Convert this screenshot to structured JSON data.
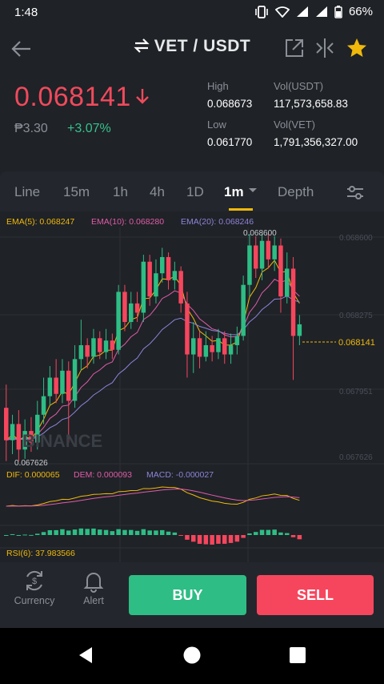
{
  "status_bar": {
    "time": "1:48",
    "battery": "66%"
  },
  "header": {
    "title": "VET / USDT"
  },
  "price": {
    "last": "0.068141",
    "fiat": "₱3.30",
    "change": "+3.07%",
    "high_label": "High",
    "high_value": "0.068673",
    "low_label": "Low",
    "low_value": "0.061770",
    "vol_usdt_label": "Vol(USDT)",
    "vol_usdt_value": "117,573,658.83",
    "vol_vet_label": "Vol(VET)",
    "vol_vet_value": "1,791,356,327.00"
  },
  "tabs": [
    {
      "label": "Line"
    },
    {
      "label": "15m"
    },
    {
      "label": "1h"
    },
    {
      "label": "4h"
    },
    {
      "label": "1D"
    },
    {
      "label": "1m"
    },
    {
      "label": "Depth"
    }
  ],
  "chart": {
    "ema5": "EMA(5): 0.068247",
    "ema10": "EMA(10): 0.068280",
    "ema20": "EMA(20): 0.068246",
    "max_label": "0.068600",
    "min_label": "0.067626",
    "axis": [
      "0.068600",
      "0.068275",
      "0.067951",
      "0.067626"
    ],
    "current_price_tag": "0.068141",
    "watermark": "BINANCE",
    "dif": "DIF: 0.000065",
    "dem": "DEM: 0.000093",
    "macd": "MACD: -0.000027",
    "rsi": "RSI(6): 37.983566",
    "colors": {
      "up": "#2ebd85",
      "down": "#f6465d",
      "ema5": "#f0b90b",
      "ema10": "#e05ca8",
      "ema20": "#8f83d8"
    }
  },
  "chart_data": {
    "type": "candlestick",
    "ylim": [
      0.067626,
      0.0686
    ],
    "candles": [
      {
        "o": 0.06785,
        "c": 0.06771,
        "h": 0.06795,
        "l": 0.06762
      },
      {
        "o": 0.06771,
        "c": 0.06778,
        "h": 0.06782,
        "l": 0.06765
      },
      {
        "o": 0.06778,
        "c": 0.06767,
        "h": 0.06784,
        "l": 0.06762
      },
      {
        "o": 0.06767,
        "c": 0.06775,
        "h": 0.0678,
        "l": 0.06763
      },
      {
        "o": 0.06775,
        "c": 0.0677,
        "h": 0.06781,
        "l": 0.06766
      },
      {
        "o": 0.0677,
        "c": 0.06782,
        "h": 0.06788,
        "l": 0.06767
      },
      {
        "o": 0.06782,
        "c": 0.0679,
        "h": 0.06798,
        "l": 0.06778
      },
      {
        "o": 0.0679,
        "c": 0.06798,
        "h": 0.06803,
        "l": 0.06786
      },
      {
        "o": 0.06798,
        "c": 0.06791,
        "h": 0.06806,
        "l": 0.06787
      },
      {
        "o": 0.06791,
        "c": 0.06801,
        "h": 0.06806,
        "l": 0.06787
      },
      {
        "o": 0.06801,
        "c": 0.06788,
        "h": 0.06805,
        "l": 0.0677
      },
      {
        "o": 0.06788,
        "c": 0.06806,
        "h": 0.06812,
        "l": 0.06785
      },
      {
        "o": 0.06806,
        "c": 0.06812,
        "h": 0.06823,
        "l": 0.06801
      },
      {
        "o": 0.06812,
        "c": 0.06807,
        "h": 0.06815,
        "l": 0.06802
      },
      {
        "o": 0.06807,
        "c": 0.06815,
        "h": 0.06819,
        "l": 0.06804
      },
      {
        "o": 0.06815,
        "c": 0.06809,
        "h": 0.06818,
        "l": 0.06806
      },
      {
        "o": 0.06809,
        "c": 0.06814,
        "h": 0.06819,
        "l": 0.06806
      },
      {
        "o": 0.06814,
        "c": 0.0681,
        "h": 0.06817,
        "l": 0.06806
      },
      {
        "o": 0.0681,
        "c": 0.06835,
        "h": 0.06838,
        "l": 0.06808
      },
      {
        "o": 0.06835,
        "c": 0.06822,
        "h": 0.06838,
        "l": 0.06818
      },
      {
        "o": 0.06822,
        "c": 0.0683,
        "h": 0.06835,
        "l": 0.06819
      },
      {
        "o": 0.0683,
        "c": 0.06826,
        "h": 0.06835,
        "l": 0.06822
      },
      {
        "o": 0.06826,
        "c": 0.06848,
        "h": 0.06851,
        "l": 0.06822
      },
      {
        "o": 0.06848,
        "c": 0.06833,
        "h": 0.06851,
        "l": 0.06829
      },
      {
        "o": 0.06833,
        "c": 0.06843,
        "h": 0.06849,
        "l": 0.0683
      },
      {
        "o": 0.06843,
        "c": 0.0685,
        "h": 0.06854,
        "l": 0.06839
      },
      {
        "o": 0.0685,
        "c": 0.0684,
        "h": 0.06852,
        "l": 0.06836
      },
      {
        "o": 0.0684,
        "c": 0.06844,
        "h": 0.06848,
        "l": 0.06836
      },
      {
        "o": 0.06844,
        "c": 0.0683,
        "h": 0.06846,
        "l": 0.06826
      },
      {
        "o": 0.0683,
        "c": 0.06808,
        "h": 0.06835,
        "l": 0.06798
      },
      {
        "o": 0.06808,
        "c": 0.06815,
        "h": 0.06822,
        "l": 0.068
      },
      {
        "o": 0.06815,
        "c": 0.06807,
        "h": 0.06818,
        "l": 0.06802
      },
      {
        "o": 0.06807,
        "c": 0.06812,
        "h": 0.06818,
        "l": 0.06805
      },
      {
        "o": 0.06812,
        "c": 0.06809,
        "h": 0.06816,
        "l": 0.06805
      },
      {
        "o": 0.06809,
        "c": 0.06815,
        "h": 0.06819,
        "l": 0.06806
      },
      {
        "o": 0.06815,
        "c": 0.06808,
        "h": 0.06818,
        "l": 0.06804
      },
      {
        "o": 0.06808,
        "c": 0.06812,
        "h": 0.06817,
        "l": 0.06804
      },
      {
        "o": 0.06812,
        "c": 0.06816,
        "h": 0.0682,
        "l": 0.06808
      },
      {
        "o": 0.06816,
        "c": 0.06838,
        "h": 0.06842,
        "l": 0.06814
      },
      {
        "o": 0.06838,
        "c": 0.06855,
        "h": 0.0686,
        "l": 0.06833
      },
      {
        "o": 0.06855,
        "c": 0.06845,
        "h": 0.06859,
        "l": 0.06841
      },
      {
        "o": 0.06845,
        "c": 0.06857,
        "h": 0.0686,
        "l": 0.0684
      },
      {
        "o": 0.06857,
        "c": 0.06849,
        "h": 0.0686,
        "l": 0.06845
      },
      {
        "o": 0.06849,
        "c": 0.06855,
        "h": 0.06859,
        "l": 0.06844
      },
      {
        "o": 0.06855,
        "c": 0.06833,
        "h": 0.06858,
        "l": 0.06826
      },
      {
        "o": 0.06833,
        "c": 0.06845,
        "h": 0.06852,
        "l": 0.0683
      },
      {
        "o": 0.06845,
        "c": 0.06816,
        "h": 0.0685,
        "l": 0.06797
      },
      {
        "o": 0.06816,
        "c": 0.06821,
        "h": 0.06825,
        "l": 0.06812
      }
    ]
  },
  "bottom": {
    "currency": "Currency",
    "alert": "Alert",
    "buy": "BUY",
    "sell": "SELL"
  }
}
